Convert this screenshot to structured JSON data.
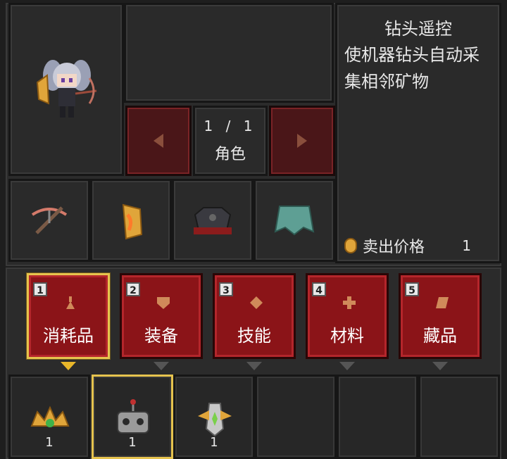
{
  "character": {
    "page_indicator": "1 / 1",
    "page_label": "角色"
  },
  "item_detail": {
    "title": "钻头遥控",
    "description": "使机器钻头自动采集相邻矿物",
    "sell_label": "卖出价格",
    "sell_price": "1"
  },
  "equipment": [
    {
      "icon": "crossbow-icon"
    },
    {
      "icon": "flame-shield-icon"
    },
    {
      "icon": "dark-armor-icon"
    },
    {
      "icon": "cape-icon"
    }
  ],
  "tabs": [
    {
      "key": "1",
      "label": "消耗品",
      "icon": "potion-icon",
      "selected": true
    },
    {
      "key": "2",
      "label": "装备",
      "icon": "shield-icon",
      "selected": false
    },
    {
      "key": "3",
      "label": "技能",
      "icon": "diamond-icon",
      "selected": false
    },
    {
      "key": "4",
      "label": "材料",
      "icon": "cross-gem-icon",
      "selected": false
    },
    {
      "key": "5",
      "label": "藏品",
      "icon": "scroll-icon",
      "selected": false
    }
  ],
  "inventory": [
    {
      "icon": "crown-icon",
      "qty": "1"
    },
    {
      "icon": "drill-remote-icon",
      "qty": "1",
      "selected": true
    },
    {
      "icon": "relic-icon",
      "qty": "1"
    },
    {
      "icon": "",
      "qty": ""
    },
    {
      "icon": "",
      "qty": ""
    },
    {
      "icon": "",
      "qty": ""
    }
  ],
  "colors": {
    "tab_red": "#8b1418",
    "selection_gold": "#e6c34e",
    "arrow_button": "#4a1618",
    "panel": "#2b2b2b"
  }
}
